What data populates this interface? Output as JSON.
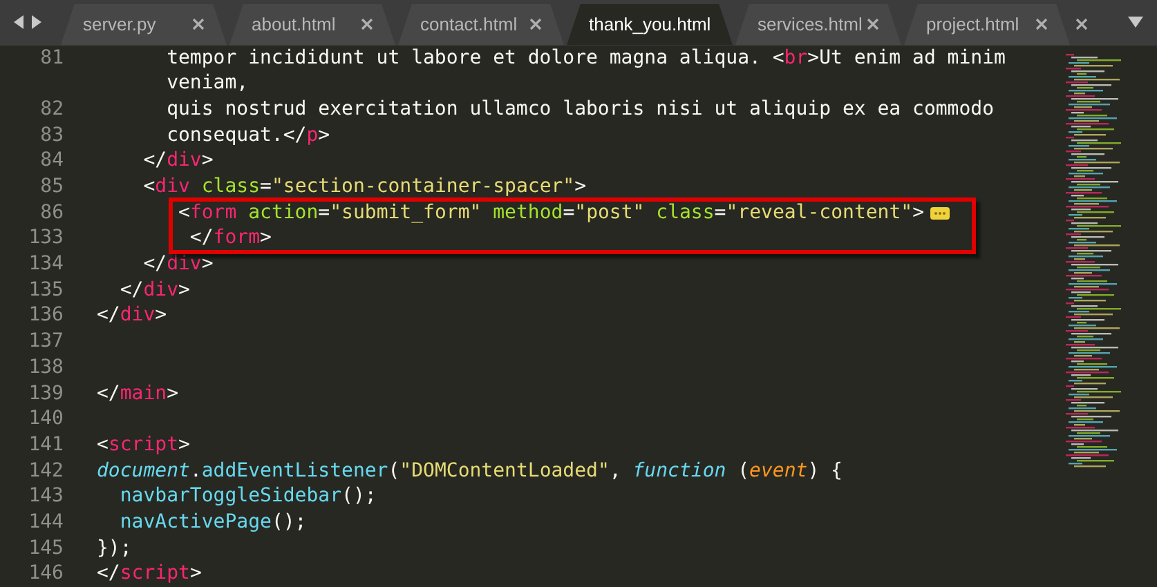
{
  "tabs": [
    {
      "label": "server.py",
      "selected": false
    },
    {
      "label": "about.html",
      "selected": false
    },
    {
      "label": "contact.html",
      "selected": false
    },
    {
      "label": "thank_you.html",
      "selected": true
    },
    {
      "label": "services.html",
      "selected": false
    },
    {
      "label": "project.html",
      "selected": false
    }
  ],
  "overflow_tab": true,
  "lines": [
    {
      "number": "81",
      "tokens": [
        {
          "kind": "plain",
          "t": "      tempor incididunt ut labore et dolore magna aliqua. <"
        },
        {
          "kind": "tag",
          "t": "br"
        },
        {
          "kind": "punct",
          "t": ">"
        },
        {
          "kind": "plain",
          "t": "Ut enim ad minim"
        }
      ]
    },
    {
      "tokens": [
        {
          "kind": "plain",
          "t": "      veniam,"
        }
      ]
    },
    {
      "number": "82",
      "tokens": [
        {
          "kind": "plain",
          "t": "      quis nostrud exercitation ullamco laboris nisi ut aliquip ex ea commodo"
        }
      ]
    },
    {
      "number": "83",
      "tokens": [
        {
          "kind": "plain",
          "t": "      consequat.</"
        },
        {
          "kind": "tag",
          "t": "p"
        },
        {
          "kind": "punct",
          "t": ">"
        }
      ]
    },
    {
      "number": "84",
      "tokens": [
        {
          "kind": "punct",
          "t": "    </"
        },
        {
          "kind": "tag",
          "t": "div"
        },
        {
          "kind": "punct",
          "t": ">"
        }
      ]
    },
    {
      "number": "85",
      "tokens": [
        {
          "kind": "punct",
          "t": "    <"
        },
        {
          "kind": "tag",
          "t": "div"
        },
        {
          "kind": "attr",
          "t": " class"
        },
        {
          "kind": "punct",
          "t": "="
        },
        {
          "kind": "string",
          "t": "\"section-container-spacer\""
        },
        {
          "kind": "punct",
          "t": ">"
        }
      ]
    },
    {
      "number": "86",
      "highlighted": true,
      "folded": true,
      "tokens": [
        {
          "kind": "punct",
          "t": "       <"
        },
        {
          "kind": "tag",
          "t": "form"
        },
        {
          "kind": "attr",
          "t": " action"
        },
        {
          "kind": "punct",
          "t": "="
        },
        {
          "kind": "string",
          "t": "\"submit_form\""
        },
        {
          "kind": "attr",
          "t": " method"
        },
        {
          "kind": "punct",
          "t": "="
        },
        {
          "kind": "string",
          "t": "\"post\""
        },
        {
          "kind": "attr",
          "t": " class"
        },
        {
          "kind": "punct",
          "t": "="
        },
        {
          "kind": "string",
          "t": "\"reveal-content\""
        },
        {
          "kind": "punct",
          "t": ">"
        }
      ]
    },
    {
      "number": "133",
      "highlighted": true,
      "folded": false,
      "tokens": [
        {
          "kind": "punct",
          "t": "        </"
        },
        {
          "kind": "tag",
          "t": "form"
        },
        {
          "kind": "punct",
          "t": ">"
        }
      ]
    },
    {
      "number": "134",
      "tokens": [
        {
          "kind": "punct",
          "t": "    </"
        },
        {
          "kind": "tag",
          "t": "div"
        },
        {
          "kind": "punct",
          "t": ">"
        }
      ]
    },
    {
      "number": "135",
      "tokens": [
        {
          "kind": "punct",
          "t": "  </"
        },
        {
          "kind": "tag",
          "t": "div"
        },
        {
          "kind": "punct",
          "t": ">"
        }
      ]
    },
    {
      "number": "136",
      "tokens": [
        {
          "kind": "punct",
          "t": "</"
        },
        {
          "kind": "tag",
          "t": "div"
        },
        {
          "kind": "punct",
          "t": ">"
        }
      ]
    },
    {
      "number": "137"
    },
    {
      "number": "138"
    },
    {
      "number": "139",
      "tokens": [
        {
          "kind": "punct",
          "t": "</"
        },
        {
          "kind": "tag",
          "t": "main"
        },
        {
          "kind": "punct",
          "t": ">"
        }
      ]
    },
    {
      "number": "140"
    },
    {
      "number": "141",
      "tokens": [
        {
          "kind": "punct",
          "t": "<"
        },
        {
          "kind": "tag",
          "t": "script"
        },
        {
          "kind": "punct",
          "t": ">"
        }
      ]
    },
    {
      "number": "142",
      "tokens": [
        {
          "kind": "object",
          "t": "document"
        },
        {
          "kind": "plain",
          "t": "."
        },
        {
          "kind": "func",
          "t": "addEventListener"
        },
        {
          "kind": "plain",
          "t": "("
        },
        {
          "kind": "string",
          "t": "\"DOMContentLoaded\""
        },
        {
          "kind": "plain",
          "t": ", "
        },
        {
          "kind": "keyword",
          "t": "function"
        },
        {
          "kind": "plain",
          "t": " ("
        },
        {
          "kind": "param",
          "t": "event"
        },
        {
          "kind": "plain",
          "t": ") {"
        }
      ]
    },
    {
      "number": "143",
      "tokens": [
        {
          "kind": "func",
          "t": "  navbarToggleSidebar"
        },
        {
          "kind": "plain",
          "t": "();"
        }
      ]
    },
    {
      "number": "144",
      "tokens": [
        {
          "kind": "func",
          "t": "  navActivePage"
        },
        {
          "kind": "plain",
          "t": "();"
        }
      ]
    },
    {
      "number": "145",
      "tokens": [
        {
          "kind": "plain",
          "t": "});"
        }
      ]
    },
    {
      "number": "146",
      "tokens": [
        {
          "kind": "punct",
          "t": "</"
        },
        {
          "kind": "tag",
          "t": "script"
        },
        {
          "kind": "punct",
          "t": ">"
        }
      ]
    }
  ]
}
